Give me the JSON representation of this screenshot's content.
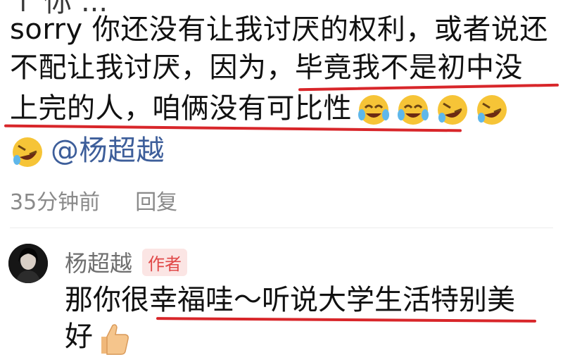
{
  "comment": {
    "cutoff_text": "↑ 你 ...",
    "line1": "sorry 你还没有让我讨厌的权利，或者说还",
    "line2_plain": "不配让我讨厌，因为，",
    "line2_highlight": "毕竟我不是初中没",
    "line3_highlight": "上完的人，咱俩没有可比性",
    "mention": "@杨超越",
    "time": "35分钟前",
    "reply_label": "回复",
    "emojis": [
      "laughing-crying-emoji",
      "laughing-crying-emoji",
      "rolling-laughing-emoji",
      "rolling-laughing-emoji",
      "rolling-laughing-emoji"
    ]
  },
  "reply": {
    "author": "杨超越",
    "badge": "作者",
    "text_plain": "那你很",
    "text_highlight": "幸福哇～听说大学生活特别美",
    "text_line2": "好",
    "emoji": "thumbs-up-emoji"
  },
  "colors": {
    "underline": "#d8262a",
    "mention": "#3d5e9a",
    "badge_text": "#e04848",
    "badge_bg": "#fbe5e4",
    "meta": "#8a8a8a"
  }
}
